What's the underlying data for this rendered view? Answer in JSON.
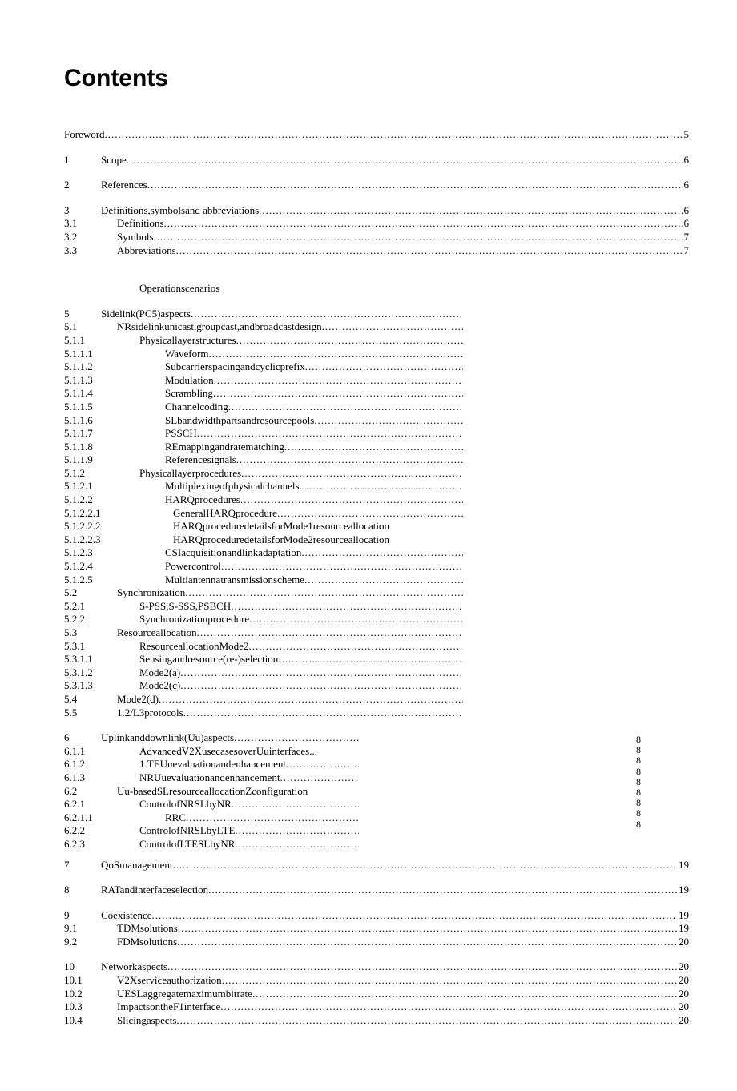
{
  "heading": "Contents",
  "entries": [
    {
      "num": "",
      "title": "Foreword",
      "page": "5",
      "lv": 0,
      "gapBefore": "",
      "dots": "full"
    },
    {
      "num": "1",
      "title": "Scope",
      "page": "6",
      "lv": 1,
      "gapBefore": "lg",
      "dots": "full"
    },
    {
      "num": "2",
      "title": "References",
      "page": "6",
      "lv": 1,
      "gapBefore": "lg",
      "dots": "full"
    },
    {
      "num": "3",
      "title": "Definitions,symbolsand    abbreviations",
      "page": "6",
      "lv": 1,
      "gapBefore": "lg",
      "dots": "full"
    },
    {
      "num": "3.1",
      "title": "Definitions",
      "page": "6",
      "lv": 2,
      "gapBefore": "",
      "dots": "full"
    },
    {
      "num": "3.2",
      "title": "Symbols",
      "page": "7",
      "lv": 2,
      "gapBefore": "",
      "dots": "full"
    },
    {
      "num": "3.3",
      "title": "Abbreviations",
      "page": "7",
      "lv": 2,
      "gapBefore": "",
      "dots": "full"
    },
    {
      "num": "",
      "title": "Operationscenarios",
      "page": "",
      "lv": 3,
      "gapBefore": "xl",
      "dots": "none"
    },
    {
      "num": "5",
      "title": "Sidelink(PC5)aspects",
      "page": "",
      "lv": 1,
      "gapBefore": "lg",
      "dots": "short"
    },
    {
      "num": "5.1",
      "title": "NRsidelinkunicast,groupcast,andbroadcastdesign",
      "page": "",
      "lv": 2,
      "gapBefore": "",
      "dots": "short"
    },
    {
      "num": "5.1.1",
      "title": "Physicallayerstructures",
      "page": "",
      "lv": 3,
      "gapBefore": "",
      "dots": "short"
    },
    {
      "num": "5.1.1.1",
      "title": "Waveform",
      "page": "",
      "lv": 4,
      "gapBefore": "",
      "dots": "short"
    },
    {
      "num": "5.1.1.2",
      "title": "Subcarrierspacingandcyclicprefix",
      "page": "",
      "lv": 4,
      "gapBefore": "",
      "dots": "short"
    },
    {
      "num": "5.1.1.3",
      "title": "Modulation",
      "page": "",
      "lv": 4,
      "gapBefore": "",
      "dots": "short"
    },
    {
      "num": "5.1.1.4",
      "title": "Scrambling",
      "page": "",
      "lv": 4,
      "gapBefore": "",
      "dots": "short"
    },
    {
      "num": "5.1.1.5",
      "title": "Channelcoding",
      "page": "",
      "lv": 4,
      "gapBefore": "",
      "dots": "short"
    },
    {
      "num": "5.1.1.6",
      "title": "SLbandwidthpartsandresourcepools",
      "page": "",
      "lv": 4,
      "gapBefore": "",
      "dots": "short"
    },
    {
      "num": "5.1.1.7",
      "title": "PSSCH",
      "page": "",
      "lv": 4,
      "gapBefore": "",
      "dots": "short"
    },
    {
      "num": "5.1.1.8",
      "title": "REmappingandratematching",
      "page": "",
      "lv": 4,
      "gapBefore": "",
      "dots": "short"
    },
    {
      "num": "5.1.1.9",
      "title": "Referencesignals",
      "page": "",
      "lv": 4,
      "gapBefore": "",
      "dots": "short"
    },
    {
      "num": "5.1.2",
      "title": "Physicallayerprocedures",
      "page": "",
      "lv": 3,
      "gapBefore": "",
      "dots": "short"
    },
    {
      "num": "5.1.2.1",
      "title": "Multiplexingofphysicalchannels",
      "page": "",
      "lv": 4,
      "gapBefore": "",
      "dots": "short"
    },
    {
      "num": "5.1.2.2",
      "title": "HARQprocedures",
      "page": "",
      "lv": 4,
      "gapBefore": "",
      "dots": "short"
    },
    {
      "num": "5.1.2.2.1",
      "title": "GeneralHARQprocedure",
      "page": "",
      "lv": 5,
      "gapBefore": "",
      "dots": "short"
    },
    {
      "num": "5.1.2.2.2",
      "title": "HARQproceduredetailsforMode1resourceallocation",
      "page": "",
      "lv": 5,
      "gapBefore": "",
      "dots": "none"
    },
    {
      "num": "5.1.2.2.3",
      "title": "HARQproceduredetailsforMode2resourceallocation",
      "page": "",
      "lv": 5,
      "gapBefore": "",
      "dots": "none"
    },
    {
      "num": "5.1.2.3",
      "title": "CSIacquisitionandlinkadaptation",
      "page": "",
      "lv": 4,
      "gapBefore": "",
      "dots": "short"
    },
    {
      "num": "5.1.2.4",
      "title": "Powercontrol",
      "page": "",
      "lv": 4,
      "gapBefore": "",
      "dots": "short"
    },
    {
      "num": "5.1.2.5",
      "title": "Multiantennatransmissionscheme",
      "page": "",
      "lv": 4,
      "gapBefore": "",
      "dots": "short"
    },
    {
      "num": "5.2",
      "title": "Synchronization",
      "page": "",
      "lv": 2,
      "gapBefore": "",
      "dots": "short"
    },
    {
      "num": "5.2.1",
      "title": "S-PSS,S-SSS,PSBCH",
      "page": "",
      "lv": 3,
      "gapBefore": "",
      "dots": "short"
    },
    {
      "num": "5.2.2",
      "title": "Synchronizationprocedure",
      "page": "",
      "lv": 3,
      "gapBefore": "",
      "dots": "short"
    },
    {
      "num": "5.3",
      "title": "Resourceallocation",
      "page": "",
      "lv": 2,
      "gapBefore": "",
      "dots": "short"
    },
    {
      "num": "5.3.1",
      "title": "ResourceallocationMode2",
      "page": "",
      "lv": 3,
      "gapBefore": "",
      "dots": "short"
    },
    {
      "num": "5.3.1.1",
      "title": "Sensingandresource(re-)selection",
      "page": "",
      "lv": 3,
      "gapBefore": "",
      "dots": "short"
    },
    {
      "num": "5.3.1.2",
      "title": "Mode2(a)",
      "page": "",
      "lv": 3,
      "gapBefore": "",
      "dots": "short"
    },
    {
      "num": "5.3.1.3",
      "title": "Mode2(c)",
      "page": "",
      "lv": 3,
      "gapBefore": "",
      "dots": "short"
    },
    {
      "num": "5.4",
      "title": "Mode2(d)",
      "page": "",
      "lv": 2,
      "gapBefore": "",
      "dots": "short"
    },
    {
      "num": "5.5",
      "title": "1.2/L3protocols",
      "page": "",
      "lv": 2,
      "gapBefore": "",
      "dots": "short"
    },
    {
      "num": "6",
      "title": "Uplinkanddownlink(Uu)aspects",
      "page": "",
      "lv": 1,
      "gapBefore": "lg",
      "dots": "short2"
    },
    {
      "num": "6.1.1",
      "title": "AdvancedV2XusecasesoverUuinterfaces...",
      "page": "",
      "lv": 3,
      "gapBefore": "",
      "dots": "none"
    },
    {
      "num": "6.1.2",
      "title": "1.TEUuevaluationandenhancement",
      "page": "",
      "lv": 3,
      "gapBefore": "",
      "dots": "short2"
    },
    {
      "num": "6.1.3",
      "title": "NRUuevaluationandenhancement",
      "page": "",
      "lv": 3,
      "gapBefore": "",
      "dots": "short2"
    },
    {
      "num": "6.2",
      "title": "Uu-basedSLresourceallocationZconfiguration",
      "page": "",
      "lv": 2,
      "gapBefore": "",
      "dots": "none"
    },
    {
      "num": "6.2.1",
      "title": "ControlofNRSLbyNR",
      "page": "",
      "lv": 3,
      "gapBefore": "",
      "dots": "short2"
    },
    {
      "num": "6.2.1.1",
      "title": "RRC",
      "page": "",
      "lv": 4,
      "gapBefore": "",
      "dots": "short2"
    },
    {
      "num": "6.2.2",
      "title": "ControlofNRSLbyLTE",
      "page": "",
      "lv": 3,
      "gapBefore": "",
      "dots": "short2"
    },
    {
      "num": "6.2.3",
      "title": "ControlofLTESLbyNR",
      "page": "",
      "lv": 3,
      "gapBefore": "",
      "dots": "short2"
    },
    {
      "num": "7",
      "title": "QoSmanagement",
      "page": "19",
      "lv": 1,
      "gapBefore": "md",
      "dots": "full"
    },
    {
      "num": "8",
      "title": "RATandinterfaceselection",
      "page": "19",
      "lv": 1,
      "gapBefore": "lg",
      "dots": "full"
    },
    {
      "num": "9",
      "title": "Coexistence",
      "page": "19",
      "lv": 1,
      "gapBefore": "lg",
      "dots": "full"
    },
    {
      "num": "9.1",
      "title": "TDMsolutions",
      "page": "19",
      "lv": 2,
      "gapBefore": "",
      "dots": "full"
    },
    {
      "num": "9.2",
      "title": "FDMsolutions",
      "page": "20",
      "lv": 2,
      "gapBefore": "",
      "dots": "full"
    },
    {
      "num": "10",
      "title": "Networkaspects",
      "page": "20",
      "lv": 1,
      "gapBefore": "lg",
      "dots": "full"
    },
    {
      "num": "10.1",
      "title": "V2Xserviceauthorization",
      "page": "20",
      "lv": 2,
      "gapBefore": "",
      "dots": "full"
    },
    {
      "num": "10.2",
      "title": "UESLaggregatemaximumbitrate",
      "page": "20",
      "lv": 2,
      "gapBefore": "",
      "dots": "full"
    },
    {
      "num": "10.3",
      "title": "ImpactsontheF1interface",
      "page": "20",
      "lv": 2,
      "gapBefore": "",
      "dots": "full"
    },
    {
      "num": "10.4",
      "title": "Slicingaspects",
      "page": "20",
      "lv": 2,
      "gapBefore": "",
      "dots": "full"
    }
  ],
  "sidePages": [
    "8",
    "8",
    "8",
    "8",
    "8",
    "8",
    "8",
    "8",
    "8"
  ]
}
